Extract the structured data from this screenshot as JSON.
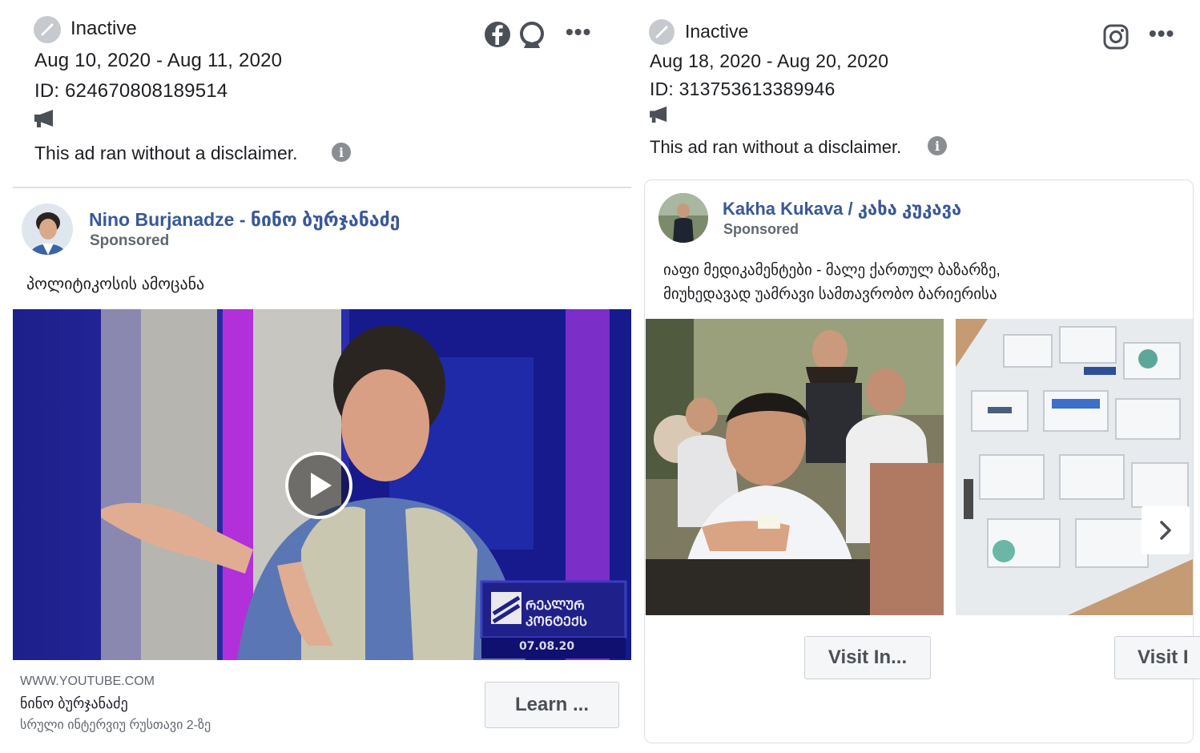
{
  "left_ad": {
    "status": "Inactive",
    "dates": "Aug 10, 2020 - Aug 11, 2020",
    "id": "ID: 624670808189514",
    "disclaimer": "This ad ran without a disclaimer.",
    "page_name": "Nino Burjanadze - ნინო ბურჯანაძე",
    "sponsored": "Sponsored",
    "body": "პოლიტიკოსის ამოცანა",
    "video_overlay_date": "07.08.20",
    "link_domain": "WWW.YOUTUBE.COM",
    "link_title": "ნინო ბურჯანაძე",
    "link_desc": "სრული ინტერვიუ რუსთავი 2-ზე",
    "cta": "Learn ...",
    "platform_icons": [
      "facebook-icon",
      "messenger-icon"
    ]
  },
  "right_ad": {
    "status": "Inactive",
    "dates": "Aug 18, 2020 - Aug 20, 2020",
    "id": "ID: 313753613389946",
    "disclaimer": "This ad ran without a disclaimer.",
    "page_name": "Kakha Kukava / კახა კუკავა",
    "sponsored": "Sponsored",
    "body_line1": "იაფი მედიკამენტები - მალე ქართულ ბაზარზე,",
    "body_line2": "მიუხედავად უამრავი სამთავრობო ბარიერისა",
    "cta_1": "Visit In...",
    "cta_2": "Visit I",
    "platform_icons": [
      "instagram-icon"
    ]
  },
  "colors": {
    "link_blue": "#385898",
    "border": "#dddfe2",
    "button_bg": "#f5f6f7"
  }
}
